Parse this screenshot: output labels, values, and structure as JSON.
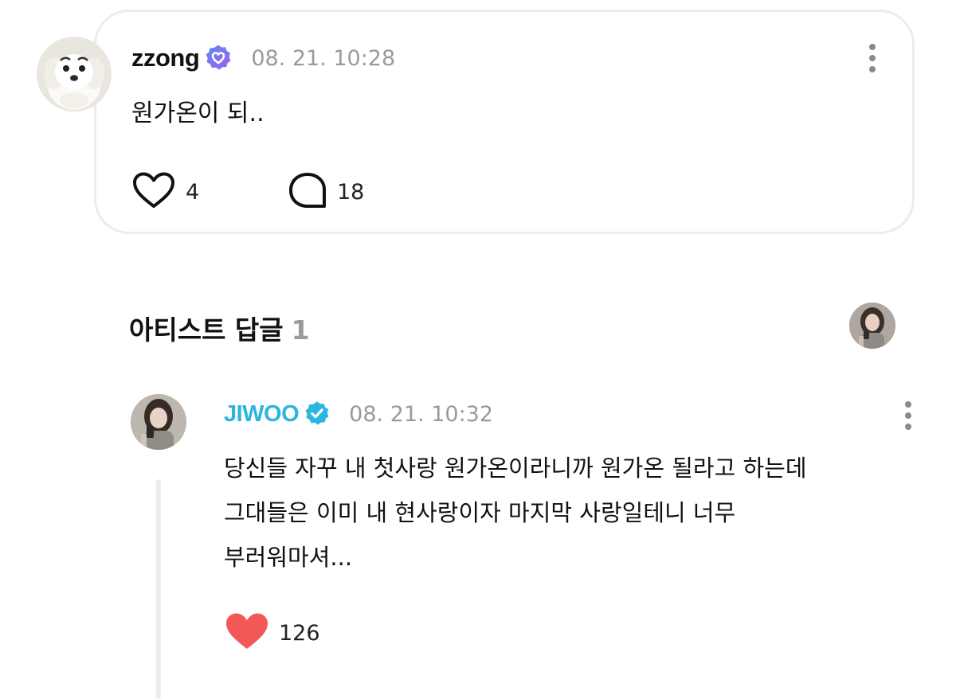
{
  "post": {
    "username": "zzong",
    "timestamp": "08. 21. 10:28",
    "text": "원가온이 되..",
    "likes": "4",
    "comments": "18",
    "icons": {
      "badge": "verified-heart-badge-icon",
      "like": "heart-outline-icon",
      "comment": "speech-bubble-icon",
      "menu": "more-vertical-icon"
    }
  },
  "artist_replies": {
    "title": "아티스트 답글",
    "count": "1"
  },
  "reply": {
    "artist_name": "JIWOO",
    "timestamp": "08. 21. 10:32",
    "lines": [
      "당신들 자꾸 내 첫사랑 원가온이라니까 원가온 될라고 하는데",
      "그대들은 이미 내 현사랑이자 마지막 사랑일테니 너무",
      "부러워마셔..."
    ],
    "likes": "126",
    "icons": {
      "badge": "verified-check-badge-icon",
      "like": "heart-filled-icon",
      "menu": "more-vertical-icon"
    }
  },
  "colors": {
    "artist_name": "#2bb5e0",
    "verified_badge_gradient": [
      "#5a8bf2",
      "#a25cf0"
    ],
    "artist_badge": "#2bb5e0",
    "liked_heart": "#f25858",
    "muted_text": "#9a9a9a",
    "card_border": "#ececec"
  }
}
